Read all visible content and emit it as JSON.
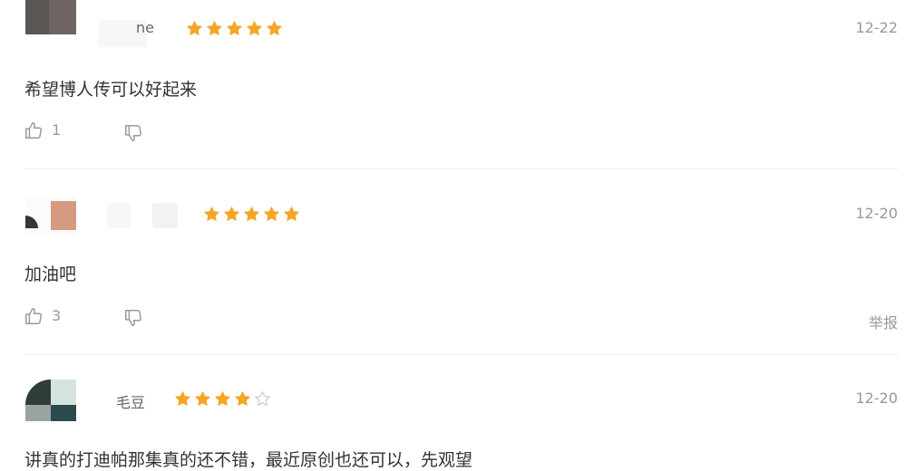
{
  "colors": {
    "star_filled": "#f5a623",
    "star_empty": "#cccccc",
    "text": "#333333",
    "muted": "#999999"
  },
  "icons": {
    "like": "thumbs-up-icon",
    "dislike": "thumbs-down-icon",
    "star": "star-icon"
  },
  "comments": [
    {
      "username": "ne",
      "rating": 5,
      "date": "12-22",
      "text": "希望博人传可以好起来",
      "like_count": "1"
    },
    {
      "username": "",
      "rating": 5,
      "date": "12-20",
      "text": "加油吧",
      "like_count": "3",
      "report_label": "举报"
    },
    {
      "username": "毛豆",
      "rating": 4,
      "date": "12-20",
      "text": "讲真的打迪帕那集真的还不错，最近原创也还可以，先观望"
    }
  ]
}
